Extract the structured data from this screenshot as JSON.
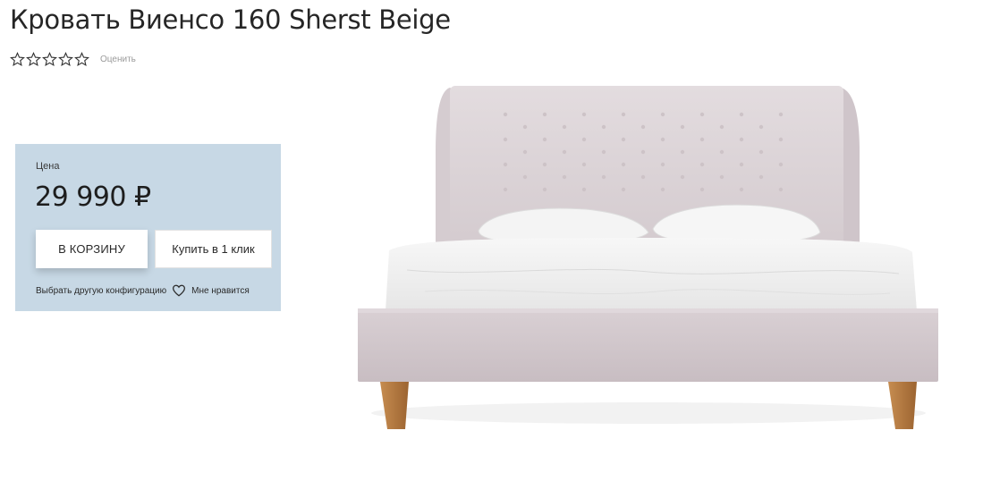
{
  "product": {
    "title": "Кровать Виенсо 160 Sherst Beige",
    "rate_label": "Оценить",
    "stars_total": 5,
    "rating": 0,
    "image_alt": "bed-image"
  },
  "price_box": {
    "label": "Цена",
    "value": "29 990 ₽",
    "add_to_cart": "В КОРЗИНУ",
    "buy_one_click": "Купить в 1 клик",
    "other_config": "Выбрать другую конфигурацию",
    "favorite": "Мне нравится",
    "icons": {
      "favorite": "heart-icon",
      "rating": "star-icon"
    }
  },
  "colors": {
    "price_box_bg": "#c7d8e5",
    "upholstery": "#d6cdd0",
    "legs": "#b3783f",
    "linen": "#f3f3f3"
  }
}
